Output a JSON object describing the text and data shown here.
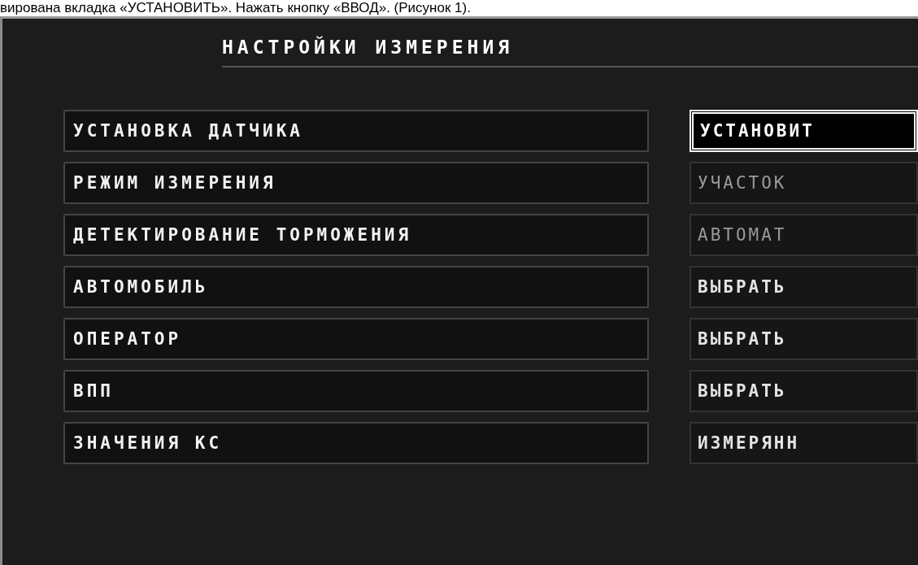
{
  "caption": "вирована вкладка «УСТАНОВИТЬ». Нажать кнопку «ВВОД». (Рисунок 1).",
  "title": "НАСТРОЙКИ ИЗМЕРЕНИЯ",
  "rows": [
    {
      "label": "УСТАНОВКА ДАТЧИКА",
      "value": "УСТАНОВИТ",
      "selected": true,
      "disabled": false
    },
    {
      "label": "РЕЖИМ ИЗМЕРЕНИЯ",
      "value": "УЧАСТОК",
      "selected": false,
      "disabled": true
    },
    {
      "label": "ДЕТЕКТИРОВАНИЕ ТОРМОЖЕНИЯ",
      "value": "АВТОМАТ",
      "selected": false,
      "disabled": true
    },
    {
      "label": "АВТОМОБИЛЬ",
      "value": "ВЫБРАТЬ",
      "selected": false,
      "disabled": false
    },
    {
      "label": "ОПЕРАТОР",
      "value": "ВЫБРАТЬ",
      "selected": false,
      "disabled": false
    },
    {
      "label": "ВПП",
      "value": "ВЫБРАТЬ",
      "selected": false,
      "disabled": false
    },
    {
      "label": "ЗНАЧЕНИЯ КС",
      "value": "ИЗМЕРЯНН",
      "selected": false,
      "disabled": false
    }
  ]
}
